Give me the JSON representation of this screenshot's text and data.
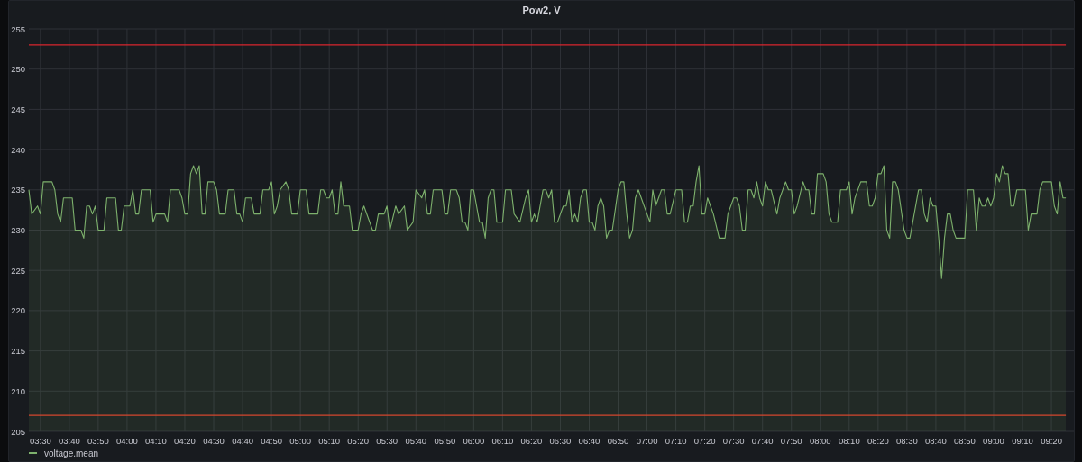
{
  "panel": {
    "chart_data": {
      "type": "area",
      "title": "Pow2, V",
      "grid": true,
      "xlim": [
        206,
        565.6
      ],
      "ylim": [
        205,
        255
      ],
      "yticks": [
        205,
        210,
        215,
        220,
        225,
        230,
        235,
        240,
        245,
        250,
        255
      ],
      "xticks": [
        {
          "value": 210,
          "label": "03:30"
        },
        {
          "value": 220,
          "label": "03:40"
        },
        {
          "value": 230,
          "label": "03:50"
        },
        {
          "value": 240,
          "label": "04:00"
        },
        {
          "value": 250,
          "label": "04:10"
        },
        {
          "value": 260,
          "label": "04:20"
        },
        {
          "value": 270,
          "label": "04:30"
        },
        {
          "value": 280,
          "label": "04:40"
        },
        {
          "value": 290,
          "label": "04:50"
        },
        {
          "value": 300,
          "label": "05:00"
        },
        {
          "value": 310,
          "label": "05:10"
        },
        {
          "value": 320,
          "label": "05:20"
        },
        {
          "value": 330,
          "label": "05:30"
        },
        {
          "value": 340,
          "label": "05:40"
        },
        {
          "value": 350,
          "label": "05:50"
        },
        {
          "value": 360,
          "label": "06:00"
        },
        {
          "value": 370,
          "label": "06:10"
        },
        {
          "value": 380,
          "label": "06:20"
        },
        {
          "value": 390,
          "label": "06:30"
        },
        {
          "value": 400,
          "label": "06:40"
        },
        {
          "value": 410,
          "label": "06:50"
        },
        {
          "value": 420,
          "label": "07:00"
        },
        {
          "value": 430,
          "label": "07:10"
        },
        {
          "value": 440,
          "label": "07:20"
        },
        {
          "value": 450,
          "label": "07:30"
        },
        {
          "value": 460,
          "label": "07:40"
        },
        {
          "value": 470,
          "label": "07:50"
        },
        {
          "value": 480,
          "label": "08:00"
        },
        {
          "value": 490,
          "label": "08:10"
        },
        {
          "value": 500,
          "label": "08:20"
        },
        {
          "value": 510,
          "label": "08:30"
        },
        {
          "value": 520,
          "label": "08:40"
        },
        {
          "value": 530,
          "label": "08:50"
        },
        {
          "value": 540,
          "label": "09:00"
        },
        {
          "value": 550,
          "label": "09:10"
        },
        {
          "value": 560,
          "label": "09:20"
        }
      ],
      "x": [
        206,
        207,
        209,
        210,
        211,
        214,
        215,
        216,
        217,
        218,
        221,
        222,
        224,
        225,
        226,
        227,
        228,
        229,
        230,
        232,
        233,
        236,
        237,
        238,
        239,
        241,
        242,
        243,
        244,
        245,
        248,
        249,
        250,
        253,
        254,
        255,
        258,
        259,
        260,
        261,
        262,
        263,
        264,
        265,
        266,
        267,
        268,
        270,
        271,
        272,
        274,
        275,
        277,
        278,
        279,
        280,
        281,
        283,
        284,
        286,
        287,
        289,
        290,
        291,
        292,
        293,
        295,
        296,
        297,
        299,
        300,
        302,
        303,
        306,
        307,
        308,
        309,
        310,
        311,
        312,
        313,
        314,
        315,
        317,
        318,
        320,
        321,
        322,
        325,
        326,
        327,
        329,
        330,
        331,
        333,
        334,
        336,
        337,
        339,
        340,
        342,
        343,
        344,
        345,
        346,
        349,
        350,
        351,
        352,
        354,
        355,
        356,
        357,
        358,
        359,
        360,
        362,
        363,
        364,
        365,
        366,
        367,
        368,
        370,
        371,
        373,
        374,
        376,
        378,
        379,
        380,
        381,
        382,
        384,
        385,
        386,
        387,
        388,
        389,
        391,
        392,
        393,
        394,
        395,
        396,
        397,
        398,
        399,
        400,
        401,
        402,
        403,
        404,
        405,
        406,
        407,
        408,
        410,
        411,
        412,
        413,
        414,
        415,
        416,
        417,
        419,
        420,
        421,
        422,
        423,
        424,
        425,
        426,
        427,
        428,
        430,
        432,
        433,
        434,
        435,
        436,
        437,
        438,
        439,
        440,
        441,
        442,
        443,
        445,
        446,
        447,
        448,
        450,
        451,
        452,
        453,
        454,
        455,
        456,
        457,
        458,
        459,
        460,
        461,
        462,
        463,
        465,
        466,
        468,
        469,
        470,
        471,
        472,
        474,
        475,
        476,
        477,
        478,
        479,
        481,
        482,
        483,
        484,
        486,
        487,
        489,
        490,
        491,
        492,
        494,
        496,
        497,
        498,
        499,
        500,
        501,
        502,
        503,
        504,
        505,
        506,
        507,
        509,
        510,
        511,
        512,
        514,
        515,
        516,
        517,
        518,
        519,
        520,
        521,
        522,
        523,
        524,
        525,
        526,
        527,
        530,
        531,
        533,
        534,
        535,
        536,
        537,
        538,
        539,
        540,
        541,
        542,
        543,
        544,
        545,
        546,
        547,
        548,
        551,
        552,
        553,
        555,
        556,
        557,
        560,
        561,
        562,
        563,
        564,
        565
      ],
      "series": [
        {
          "name": "voltage.mean",
          "color": "#7eb26d",
          "values": [
            235,
            232,
            233,
            232,
            236,
            236,
            235,
            232,
            231,
            234,
            234,
            230,
            230,
            229,
            233,
            233,
            232,
            233,
            230,
            230,
            234,
            234,
            230,
            230,
            233,
            233,
            235,
            232,
            232,
            235,
            235,
            231,
            232,
            232,
            231,
            235,
            235,
            234,
            232,
            232,
            237,
            238,
            237,
            238,
            232,
            232,
            236,
            236,
            235,
            232,
            232,
            235,
            235,
            232,
            232,
            231,
            234,
            234,
            232,
            232,
            235,
            235,
            236,
            232,
            233,
            235,
            236,
            235,
            232,
            232,
            235,
            235,
            232,
            232,
            235,
            235,
            234,
            234,
            235,
            232,
            232,
            236,
            233,
            233,
            230,
            230,
            232,
            233,
            230,
            230,
            232,
            232,
            233,
            230,
            233,
            232,
            233,
            230,
            231,
            235,
            234,
            235,
            232,
            232,
            235,
            235,
            232,
            232,
            235,
            235,
            234,
            231,
            231,
            230,
            235,
            235,
            231,
            231,
            229,
            234,
            235,
            235,
            231,
            231,
            235,
            235,
            232,
            231,
            234,
            235,
            231,
            232,
            231,
            235,
            235,
            234,
            235,
            231,
            231,
            233,
            233,
            235,
            231,
            232,
            231,
            234,
            235,
            235,
            231,
            231,
            230,
            233,
            234,
            233,
            229,
            230,
            230,
            235,
            236,
            236,
            232,
            229,
            230,
            234,
            235,
            233,
            232,
            231,
            235,
            233,
            234,
            235,
            235,
            232,
            232,
            235,
            235,
            231,
            231,
            233,
            233,
            236,
            238,
            232,
            232,
            234,
            233,
            232,
            229,
            229,
            229,
            232,
            234,
            234,
            233,
            230,
            230,
            235,
            235,
            234,
            236,
            234,
            233,
            236,
            235,
            235,
            232,
            234,
            236,
            235,
            235,
            232,
            233,
            236,
            235,
            235,
            232,
            232,
            237,
            237,
            236,
            232,
            231,
            231,
            235,
            235,
            236,
            232,
            234,
            236,
            236,
            233,
            233,
            234,
            237,
            237,
            238,
            230,
            229,
            236,
            236,
            235,
            230,
            229,
            229,
            231,
            235,
            235,
            232,
            231,
            234,
            233,
            233,
            229,
            224,
            229,
            232,
            232,
            230,
            229,
            229,
            235,
            235,
            230,
            234,
            233,
            233,
            234,
            233,
            234,
            237,
            236,
            238,
            237,
            237,
            233,
            233,
            235,
            235,
            230,
            232,
            232,
            235,
            236,
            236,
            233,
            232,
            236,
            234,
            234
          ]
        },
        {
          "color": "#d8262e",
          "type": "line",
          "values": [
            253,
            253,
            253,
            253,
            253,
            253,
            253,
            253,
            253,
            253,
            253,
            253,
            253,
            253,
            253,
            253,
            253,
            253,
            253,
            253,
            253,
            253,
            253,
            253,
            253,
            253,
            253,
            253,
            253,
            253,
            253,
            253,
            253,
            253,
            253,
            253,
            253,
            253,
            253,
            253,
            253,
            253,
            253,
            253,
            253,
            253,
            253,
            253,
            253,
            253,
            253,
            253,
            253,
            253,
            253,
            253,
            253,
            253,
            253,
            253,
            253,
            253,
            253,
            253,
            253,
            253,
            253,
            253,
            253,
            253,
            253,
            253,
            253,
            253,
            253,
            253,
            253,
            253,
            253,
            253,
            253,
            253,
            253,
            253,
            253,
            253,
            253,
            253,
            253,
            253,
            253,
            253,
            253,
            253,
            253,
            253,
            253,
            253,
            253,
            253,
            253,
            253,
            253,
            253,
            253,
            253,
            253,
            253,
            253,
            253,
            253,
            253,
            253,
            253,
            253,
            253,
            253,
            253,
            253,
            253,
            253,
            253,
            253,
            253,
            253,
            253,
            253,
            253,
            253,
            253,
            253,
            253,
            253,
            253,
            253,
            253,
            253,
            253,
            253,
            253,
            253,
            253,
            253,
            253,
            253,
            253,
            253,
            253,
            253,
            253,
            253,
            253,
            253,
            253,
            253,
            253,
            253,
            253,
            253,
            253,
            253,
            253,
            253,
            253,
            253,
            253,
            253,
            253,
            253,
            253,
            253,
            253,
            253,
            253,
            253,
            253,
            253,
            253,
            253,
            253,
            253,
            253,
            253,
            253,
            253,
            253,
            253,
            253,
            253,
            253,
            253,
            253,
            253,
            253,
            253,
            253,
            253,
            253,
            253,
            253,
            253,
            253,
            253,
            253,
            253,
            253,
            253,
            253,
            253,
            253,
            253,
            253,
            253,
            253,
            253,
            253,
            253,
            253,
            253,
            253,
            253,
            253,
            253,
            253,
            253,
            253,
            253,
            253,
            253,
            253,
            253,
            253,
            253,
            253,
            253,
            253,
            253,
            253,
            253,
            253,
            253,
            253,
            253,
            253,
            253,
            253,
            253,
            253,
            253,
            253,
            253,
            253,
            253,
            253,
            253,
            253,
            253,
            253,
            253,
            253,
            253,
            253,
            253,
            253,
            253,
            253,
            253,
            253,
            253,
            253,
            253,
            253,
            253,
            253,
            253,
            253,
            253,
            253,
            253,
            253,
            253,
            253,
            253,
            253,
            253,
            253,
            253,
            253,
            253,
            253
          ]
        },
        {
          "color": "#d4472e",
          "type": "line",
          "values": [
            207,
            207,
            207,
            207,
            207,
            207,
            207,
            207,
            207,
            207,
            207,
            207,
            207,
            207,
            207,
            207,
            207,
            207,
            207,
            207,
            207,
            207,
            207,
            207,
            207,
            207,
            207,
            207,
            207,
            207,
            207,
            207,
            207,
            207,
            207,
            207,
            207,
            207,
            207,
            207,
            207,
            207,
            207,
            207,
            207,
            207,
            207,
            207,
            207,
            207,
            207,
            207,
            207,
            207,
            207,
            207,
            207,
            207,
            207,
            207,
            207,
            207,
            207,
            207,
            207,
            207,
            207,
            207,
            207,
            207,
            207,
            207,
            207,
            207,
            207,
            207,
            207,
            207,
            207,
            207,
            207,
            207,
            207,
            207,
            207,
            207,
            207,
            207,
            207,
            207,
            207,
            207,
            207,
            207,
            207,
            207,
            207,
            207,
            207,
            207,
            207,
            207,
            207,
            207,
            207,
            207,
            207,
            207,
            207,
            207,
            207,
            207,
            207,
            207,
            207,
            207,
            207,
            207,
            207,
            207,
            207,
            207,
            207,
            207,
            207,
            207,
            207,
            207,
            207,
            207,
            207,
            207,
            207,
            207,
            207,
            207,
            207,
            207,
            207,
            207,
            207,
            207,
            207,
            207,
            207,
            207,
            207,
            207,
            207,
            207,
            207,
            207,
            207,
            207,
            207,
            207,
            207,
            207,
            207,
            207,
            207,
            207,
            207,
            207,
            207,
            207,
            207,
            207,
            207,
            207,
            207,
            207,
            207,
            207,
            207,
            207,
            207,
            207,
            207,
            207,
            207,
            207,
            207,
            207,
            207,
            207,
            207,
            207,
            207,
            207,
            207,
            207,
            207,
            207,
            207,
            207,
            207,
            207,
            207,
            207,
            207,
            207,
            207,
            207,
            207,
            207,
            207,
            207,
            207,
            207,
            207,
            207,
            207,
            207,
            207,
            207,
            207,
            207,
            207,
            207,
            207,
            207,
            207,
            207,
            207,
            207,
            207,
            207,
            207,
            207,
            207,
            207,
            207,
            207,
            207,
            207,
            207,
            207,
            207,
            207,
            207,
            207,
            207,
            207,
            207,
            207,
            207,
            207,
            207,
            207,
            207,
            207,
            207,
            207,
            207,
            207,
            207,
            207,
            207,
            207,
            207,
            207,
            207,
            207,
            207,
            207,
            207,
            207,
            207,
            207,
            207,
            207,
            207,
            207,
            207,
            207,
            207,
            207,
            207,
            207,
            207,
            207,
            207,
            207,
            207,
            207,
            207,
            207,
            207,
            207
          ]
        }
      ]
    }
  }
}
